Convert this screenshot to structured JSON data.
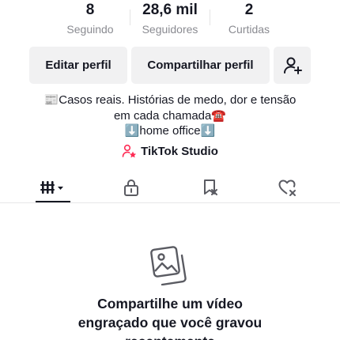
{
  "stats": [
    {
      "value": "8",
      "label": "Seguindo"
    },
    {
      "value": "28,6 mil",
      "label": "Seguidores"
    },
    {
      "value": "2",
      "label": "Curtidas"
    }
  ],
  "buttons": {
    "edit_profile": "Editar perfil",
    "share_profile": "Compartilhar perfil"
  },
  "bio": {
    "line1": "📰Casos reais. Histórias de medo, dor e tensão",
    "line2": "em cada chamada☎️",
    "line3": "⬇️home office⬇️"
  },
  "studio": {
    "label": "TikTok Studio"
  },
  "tabs": [
    {
      "icon": "videos-grid-icon",
      "active": true
    },
    {
      "icon": "lock-icon",
      "active": false
    },
    {
      "icon": "bookmark-icon",
      "active": false
    },
    {
      "icon": "liked-heart-icon",
      "active": false
    }
  ],
  "empty_state": {
    "line1": "Compartilhe um vídeo",
    "line2": "engraçado que você gravou",
    "line3": "recentemente"
  },
  "colors": {
    "text": "#161823",
    "muted": "#8a8b91",
    "button_bg": "#f1f1f2",
    "accent": "#fe2c55"
  }
}
